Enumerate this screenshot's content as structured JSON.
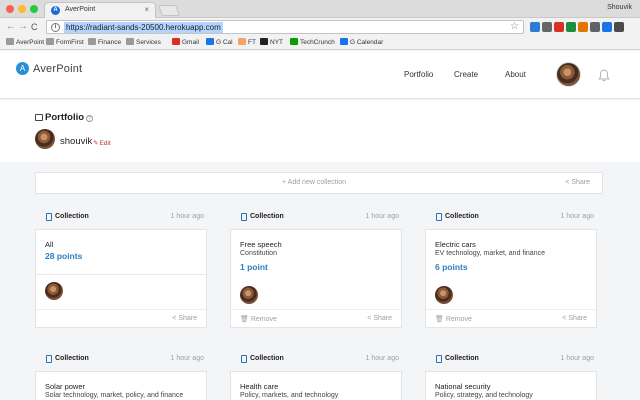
{
  "browser": {
    "tab_title": "AverPoint",
    "tab_favicon": "A",
    "tab_close": "×",
    "user_name": "Shouvik",
    "url": "https://radiant-sands-20500.herokuapp.com",
    "nav": {
      "back": "←",
      "forward": "→",
      "reload": "C"
    },
    "star": "☆",
    "menu": "⋮",
    "extensions": [
      "#2d7bd4",
      "#666666",
      "#d93025",
      "#1e8e3e",
      "#e37400",
      "#5f6368",
      "#1a73e8",
      "#4b4b4b"
    ],
    "bookmarks": [
      {
        "label": "AverPoint",
        "icon": "folder-icon"
      },
      {
        "label": "FormFirst",
        "icon": "folder-icon"
      },
      {
        "label": "Finance",
        "icon": "folder-icon"
      },
      {
        "label": "Services",
        "icon": "folder-icon"
      },
      {
        "label": "Gmail",
        "icon": "gmail-icon",
        "color": "#d93025"
      },
      {
        "label": "G Cal",
        "icon": "calendar-icon",
        "color": "#1a73e8"
      },
      {
        "label": "FT",
        "icon": "ft-icon",
        "color": "#f2a365"
      },
      {
        "label": "NYT",
        "icon": "nyt-icon",
        "color": "#222222"
      },
      {
        "label": "TechCrunch",
        "icon": "techcrunch-icon",
        "color": "#0a9e01"
      },
      {
        "label": "G Calendar",
        "icon": "calendar-icon",
        "color": "#1a73e8"
      }
    ]
  },
  "app": {
    "logo_mark": "A",
    "logo_text": "AverPoint",
    "nav": {
      "portfolio": "Portfolio",
      "create": "Create",
      "about": "About"
    },
    "accent": "#2b7fc3"
  },
  "profile": {
    "title": "Portfolio",
    "help": "?",
    "name": "shouvik",
    "edit": "Edit",
    "pencil": "✎"
  },
  "add_bar": {
    "add_label": "+ Add new collection",
    "share_label": "< Share"
  },
  "collections": [
    {
      "head": "Collection",
      "time": "1 hour ago",
      "title": "All",
      "subtitle": "",
      "points": "28 points",
      "remove": "",
      "share": "< Share"
    },
    {
      "head": "Collection",
      "time": "1 hour ago",
      "title": "Free speech",
      "subtitle": "Constitution",
      "points": "1 point",
      "remove": "Remove",
      "share": "< Share"
    },
    {
      "head": "Collection",
      "time": "1 hour ago",
      "title": "Electric cars",
      "subtitle": "EV technology, market, and finance",
      "points": "6 points",
      "remove": "Remove",
      "share": "< Share"
    },
    {
      "head": "Collection",
      "time": "1 hour ago",
      "title": "Solar power",
      "subtitle": "Solar technology, market, policy, and finance"
    },
    {
      "head": "Collection",
      "time": "1 hour ago",
      "title": "Health care",
      "subtitle": "Policy, markets, and technology"
    },
    {
      "head": "Collection",
      "time": "1 hour ago",
      "title": "National security",
      "subtitle": "Policy, strategy, and technology"
    }
  ]
}
